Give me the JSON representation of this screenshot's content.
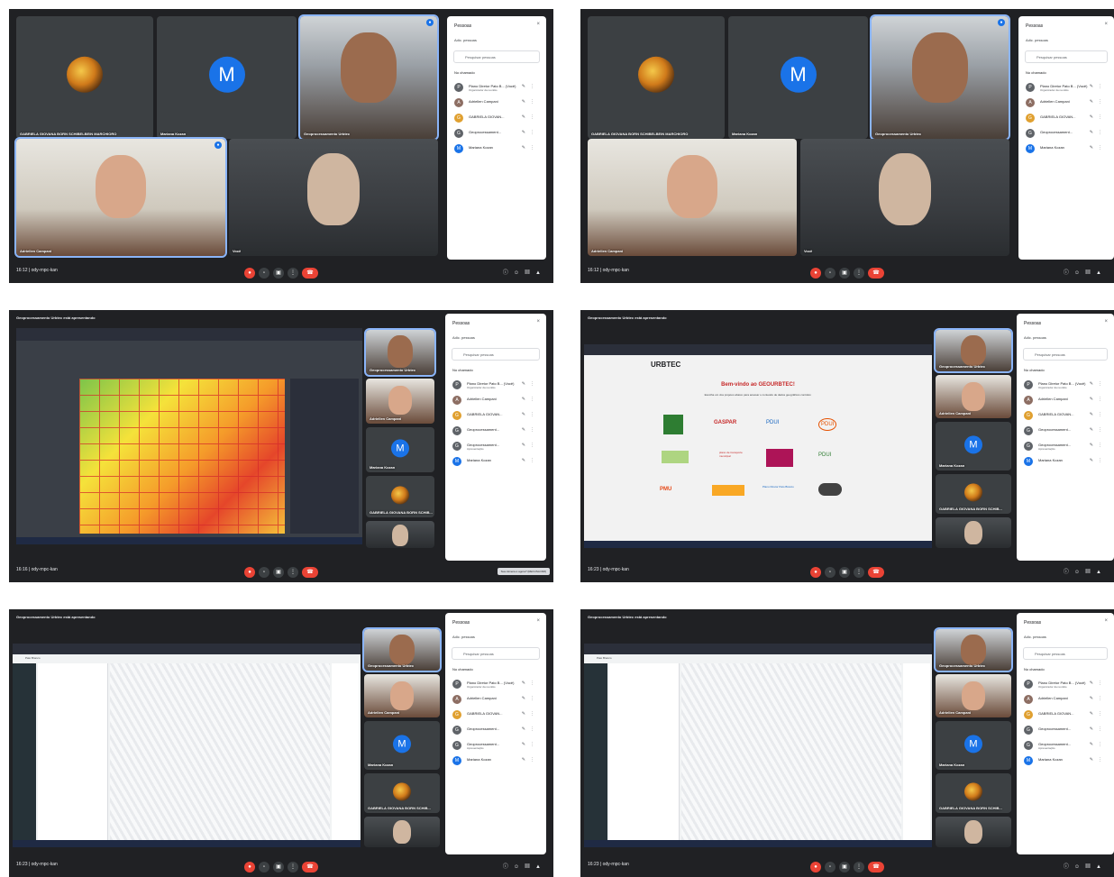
{
  "meeting_code": "16:12 | ody-rnpc-kan",
  "people": {
    "title": "Pessoas",
    "close": "×",
    "add": "Adic. pessoas",
    "search_placeholder": "Pesquisar pessoas",
    "section": "No chamado",
    "list": [
      {
        "name": "Plano Diretor Pato B... (Você)",
        "sub": "Organizador da reunião",
        "avatar": "P",
        "color": "#5f6368"
      },
      {
        "name": "Adriellen Campani",
        "sub": "",
        "avatar": "A",
        "color": "#8d6e63"
      },
      {
        "name": "GABRIELA GIOVAN...",
        "sub": "",
        "avatar": "G",
        "color": "#e0a030"
      },
      {
        "name": "Geoprocessament...",
        "sub": "",
        "avatar": "G",
        "color": "#5f6368"
      },
      {
        "name": "Mariana Kozan",
        "sub": "",
        "avatar": "M",
        "color": "#1a73e8"
      }
    ],
    "list_b": [
      {
        "name": "Plano Diretor Pato B... (Você)",
        "sub": "Organizador da reunião",
        "avatar": "P",
        "color": "#5f6368"
      },
      {
        "name": "Adriellen Campani",
        "sub": "",
        "avatar": "A",
        "color": "#8d6e63"
      },
      {
        "name": "GABRIELA GIOVAN...",
        "sub": "",
        "avatar": "G",
        "color": "#e0a030"
      },
      {
        "name": "Geoprocessament...",
        "sub": "",
        "avatar": "G",
        "color": "#5f6368"
      },
      {
        "name": "Geoprocessament...",
        "sub": "Apresentação",
        "avatar": "G",
        "color": "#5f6368"
      },
      {
        "name": "Mariana Kozan",
        "sub": "",
        "avatar": "M",
        "color": "#1a73e8"
      }
    ]
  },
  "tiles": {
    "gabriela": "GABRIELA GIOVANA BORN SCHIBELBEIN MARCHIORO",
    "gabriela_short": "GABRIELA GIOVANA BORN SCHIB...",
    "mariana": "Mariana Kozan",
    "geo": "Geoprocessamento Urbtec",
    "geo_short": "Geoprocessamento Urbtec",
    "adriellen": "Adriellen Campani",
    "voce": "Você",
    "avatar_m": "M"
  },
  "presenting": "Geoprocessamento Urbtec está apresentando",
  "time_a": "16:12 | ody-rnpc-kan",
  "time_b": "16:16 | ody-rnpc-kan",
  "time_c": "16:23 | ody-rnpc-kan",
  "geourbtec": {
    "logo": "URBTEC",
    "welcome": "Bem-vindo ao GEOURBTEC!",
    "subtitle": "Escolha um dos projetos abaixo para acessar o conteúdo de dados geográficos contidos:",
    "logos": [
      "GASPAR",
      "PDUI",
      "PDUI",
      "plano de transporte municipal",
      "PDUI",
      "PMU",
      "Plano Diretor Pato Branco"
    ]
  },
  "gis_tab": "Pato Branco",
  "notice": "Sua câmera é agora? (RECUSA DIM)",
  "colors": {
    "accent": "#1a73e8",
    "end_call": "#ea4335",
    "bg": "#202124"
  }
}
